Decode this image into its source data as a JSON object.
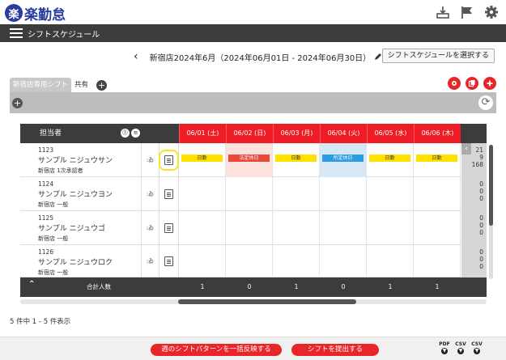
{
  "app": {
    "logo_mark": "楽",
    "logo_text": "楽勤怠"
  },
  "icons": {
    "inbox": "inbox-icon",
    "flag": "flag-icon",
    "gear": "gear-icon"
  },
  "nav": {
    "title": "シフトスケジュール"
  },
  "period": {
    "prev": "‹",
    "text": "新宿店2024年6月（2024年06月01日 - 2024年06月30日）",
    "select_button": "シフトスケジュールを選択する"
  },
  "tabs": [
    {
      "label": "新宿店専用シフト"
    },
    {
      "label": "共有"
    }
  ],
  "table": {
    "header_name": "担当者",
    "days": [
      "06/01 (土)",
      "06/02 (日)",
      "06/03 (月)",
      "06/04 (火)",
      "06/05 (水)",
      "06/06 (木)"
    ],
    "rows": [
      {
        "code": "1123",
        "name": "サンプル ニジュウサン",
        "org": "新宿店 1次承認者",
        "icon1": ":ゐ",
        "cells": [
          {
            "label": "日勤",
            "type": "yellow",
            "bg": ""
          },
          {
            "label": "法定休日",
            "type": "red",
            "bg": "pink"
          },
          {
            "label": "日勤",
            "type": "yellow",
            "bg": ""
          },
          {
            "label": "所定休日",
            "type": "bluebg",
            "bg": "blue"
          },
          {
            "label": "日勤",
            "type": "yellow",
            "bg": ""
          },
          {
            "label": "日勤",
            "type": "yellow",
            "bg": ""
          }
        ],
        "totals": [
          "21",
          "9",
          "168"
        ]
      },
      {
        "code": "1124",
        "name": "サンプル ニジュウヨン",
        "org": "新宿店 一般",
        "icon1": ":ゐ",
        "cells": [],
        "totals": [
          "0",
          "0",
          "0"
        ]
      },
      {
        "code": "1125",
        "name": "サンプル ニジュウゴ",
        "org": "新宿店 一般",
        "icon1": ":ゐ",
        "cells": [],
        "totals": [
          "0",
          "0",
          "0"
        ]
      },
      {
        "code": "1126",
        "name": "サンプル ニジュウロク",
        "org": "新宿店 一般",
        "icon1": ":ゐ",
        "cells": [],
        "totals": [
          "0",
          "0",
          "0"
        ]
      }
    ],
    "footer_label": "合計人数",
    "footer_values": [
      "1",
      "0",
      "1",
      "0",
      "1",
      "1"
    ]
  },
  "count_text": "5 件中 1 - 5 件表示",
  "bottom": {
    "apply_pattern": "週のシフトパターンを一括反映する",
    "submit_shift": "シフトを提出する",
    "downloads": [
      "PDF",
      "CSV",
      "CSV"
    ]
  },
  "colors": {
    "accent_red": "#e8262a",
    "brand_blue": "#2a3c9c",
    "dark": "#3c3c3c"
  }
}
